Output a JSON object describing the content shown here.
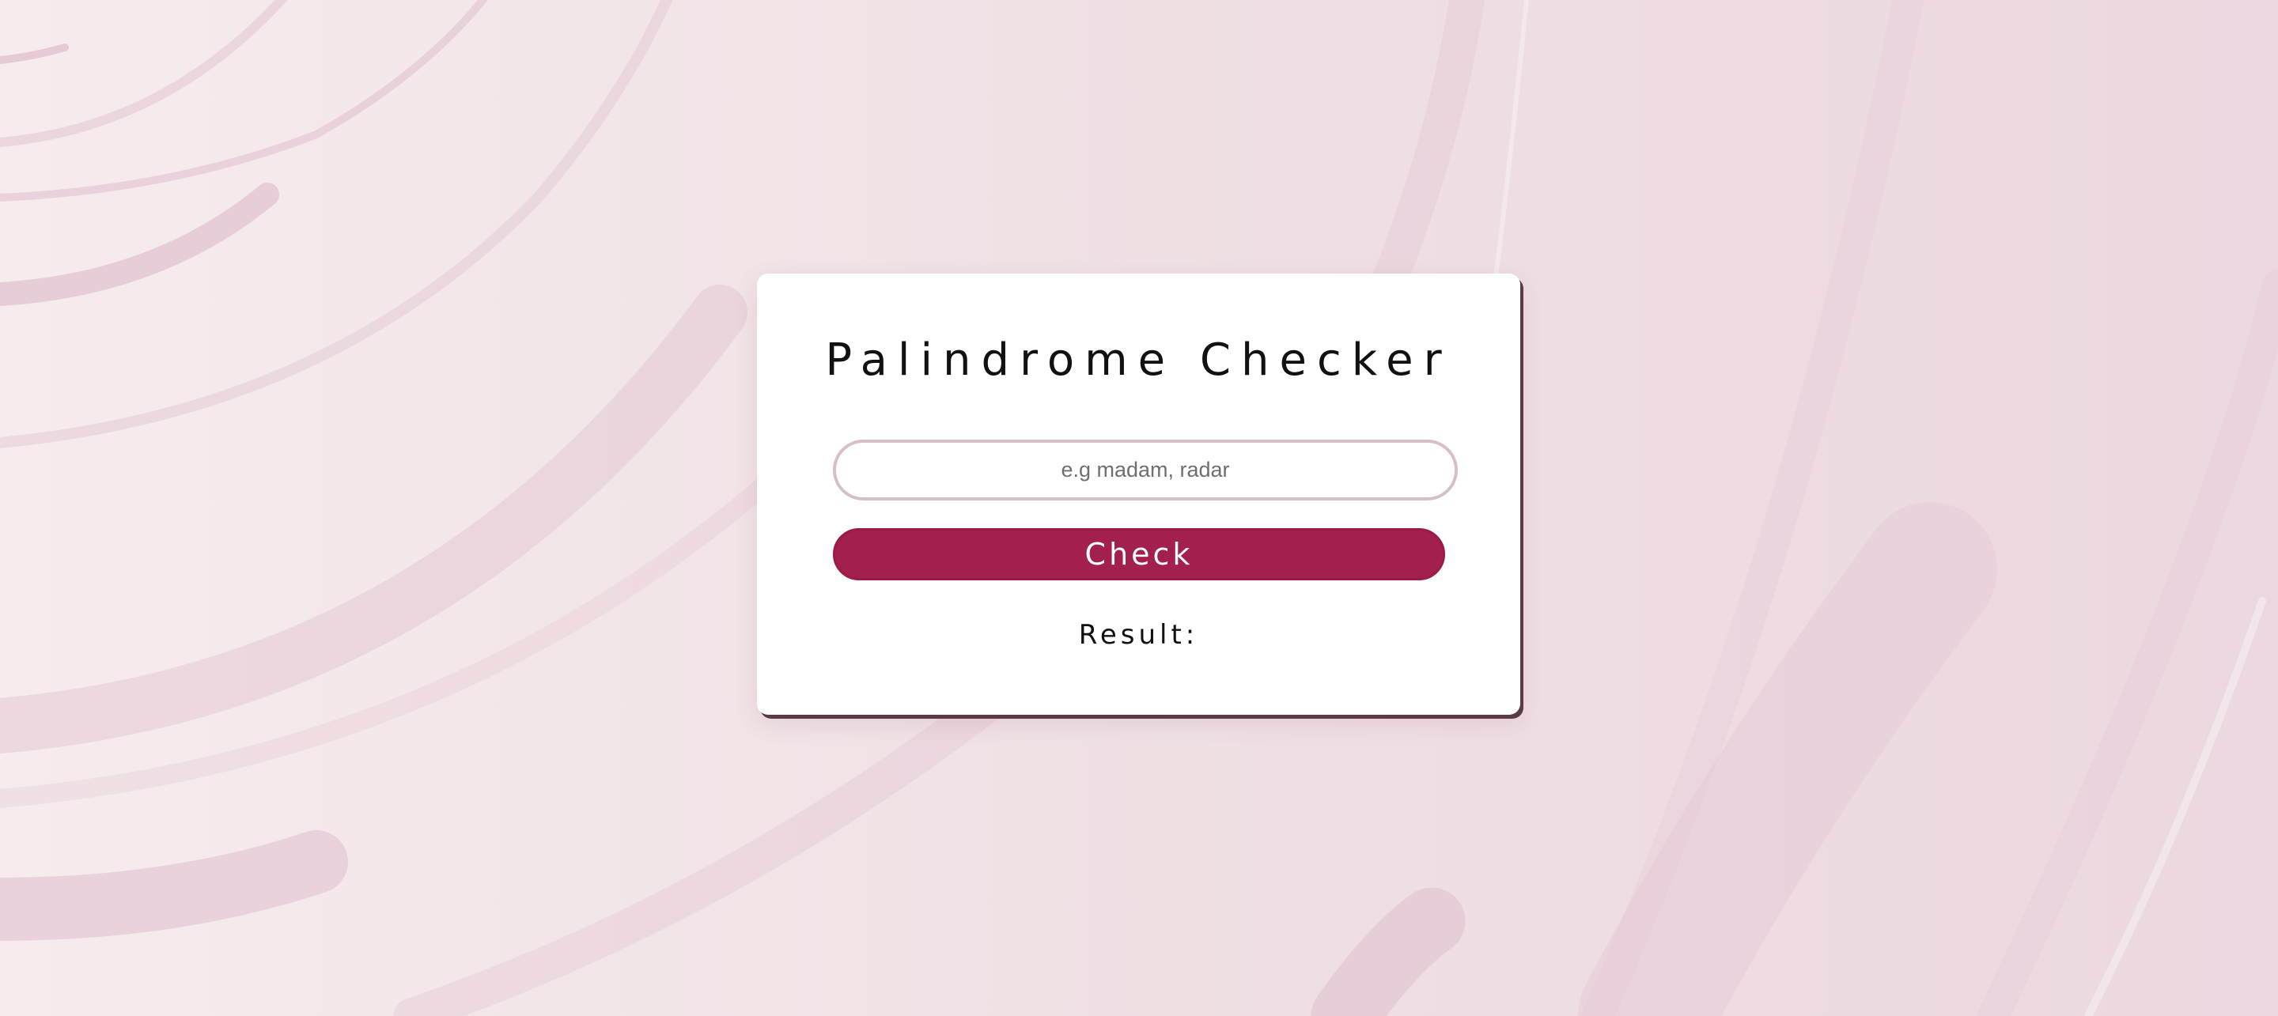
{
  "app": {
    "title": "Palindrome Checker"
  },
  "form": {
    "input_value": "",
    "input_placeholder": "e.g madam, radar",
    "check_label": "Check",
    "result_label": "Result:"
  },
  "theme": {
    "accent": "#a31f4d",
    "card_background": "#ffffff",
    "card_shadow": "#5a3a44",
    "input_border": "#d8bfc7",
    "page_background": "#f0e1e5",
    "decor_arc": "#e3c5d3"
  }
}
